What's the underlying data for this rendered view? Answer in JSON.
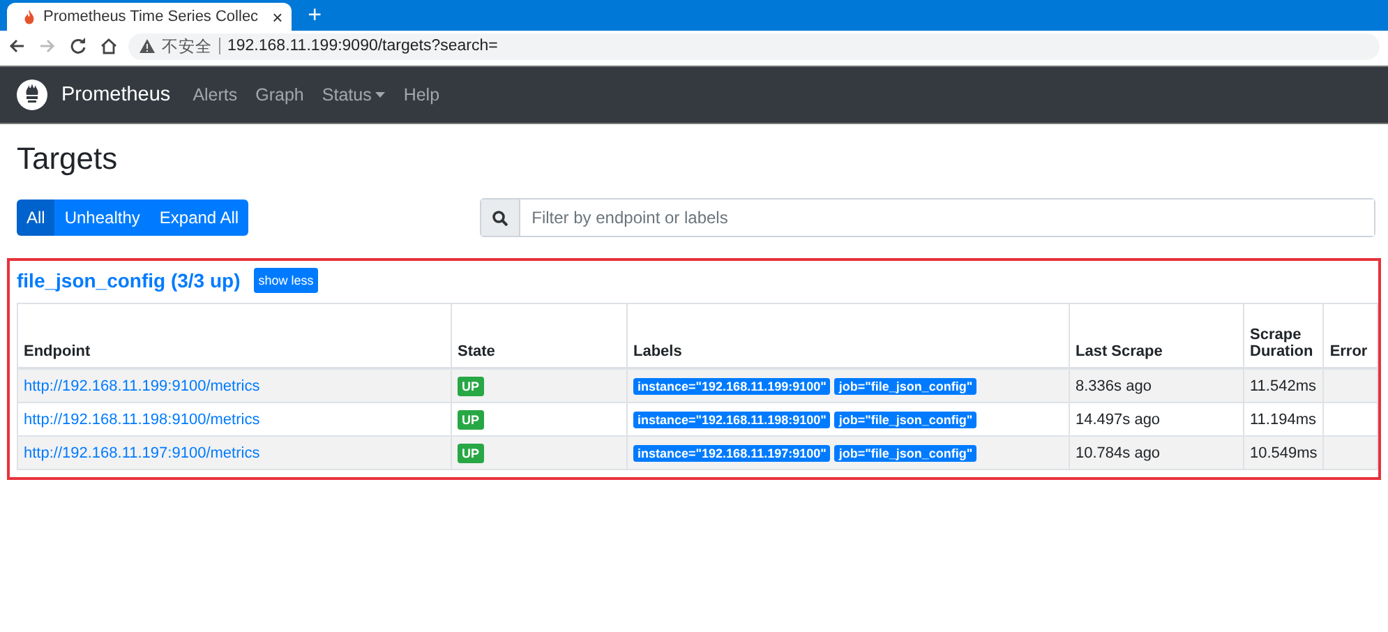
{
  "browser": {
    "tab": {
      "title": "Prometheus Time Series Collec",
      "close": "×"
    },
    "new_tab": "+",
    "security": "不安全",
    "url": "192.168.11.199:9090/targets?search="
  },
  "navbar": {
    "brand": "Prometheus",
    "items": [
      {
        "label": "Alerts",
        "dropdown": false
      },
      {
        "label": "Graph",
        "dropdown": false
      },
      {
        "label": "Status",
        "dropdown": true
      },
      {
        "label": "Help",
        "dropdown": false
      }
    ]
  },
  "page": {
    "title": "Targets",
    "filters": [
      {
        "label": "All",
        "selected": true
      },
      {
        "label": "Unhealthy",
        "selected": false
      },
      {
        "label": "Expand All",
        "selected": false
      }
    ],
    "search": {
      "placeholder": "Filter by endpoint or labels"
    },
    "pools": [
      {
        "name": "file_json_config (3/3 up)",
        "toggle": "show less",
        "highlighted": true,
        "columns": [
          "Endpoint",
          "State",
          "Labels",
          "Last Scrape",
          "Scrape Duration",
          "Error"
        ],
        "rows": [
          {
            "endpoint": "http://192.168.11.199:9100/metrics",
            "state": "UP",
            "color": "#28a745",
            "labels": [
              "instance=\"192.168.11.199:9100\"",
              "job=\"file_json_config\""
            ],
            "last_scrape": "8.336s ago",
            "scrape_duration": "11.542ms"
          },
          {
            "endpoint": "http://192.168.11.198:9100/metrics",
            "state": "UP",
            "color": "#28a745",
            "labels": [
              "instance=\"192.168.11.198:9100\"",
              "job=\"file_json_config\""
            ],
            "last_scrape": "14.497s ago",
            "scrape_duration": "11.194ms"
          },
          {
            "endpoint": "http://192.168.11.197:9100/metrics",
            "state": "UP",
            "color": "#28a745",
            "labels": [
              "instance=\"192.168.11.197:9100\"",
              "job=\"file_json_config\""
            ],
            "last_scrape": "10.784s ago",
            "scrape_duration": "10.549ms"
          }
        ]
      }
    ]
  }
}
